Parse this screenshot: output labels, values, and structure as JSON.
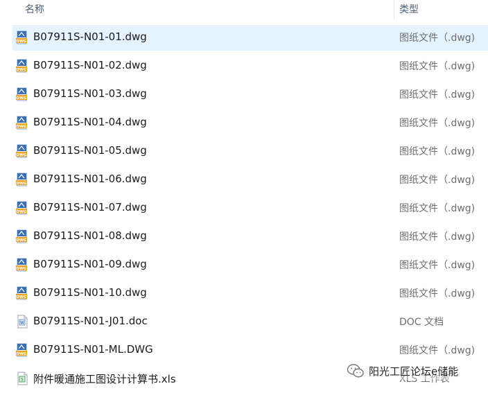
{
  "header": {
    "name_label": "名称",
    "type_label": "类型",
    "sort_indicator": "^"
  },
  "files": [
    {
      "name": "B07911S-N01-01.dwg",
      "type": "图纸文件（.dwg)",
      "icon": "dwg-file-icon",
      "selected": true
    },
    {
      "name": "B07911S-N01-02.dwg",
      "type": "图纸文件（.dwg)",
      "icon": "dwg-file-icon"
    },
    {
      "name": "B07911S-N01-03.dwg",
      "type": "图纸文件（.dwg)",
      "icon": "dwg-file-icon"
    },
    {
      "name": "B07911S-N01-04.dwg",
      "type": "图纸文件（.dwg)",
      "icon": "dwg-file-icon"
    },
    {
      "name": "B07911S-N01-05.dwg",
      "type": "图纸文件（.dwg)",
      "icon": "dwg-file-icon"
    },
    {
      "name": "B07911S-N01-06.dwg",
      "type": "图纸文件（.dwg)",
      "icon": "dwg-file-icon"
    },
    {
      "name": "B07911S-N01-07.dwg",
      "type": "图纸文件（.dwg)",
      "icon": "dwg-file-icon"
    },
    {
      "name": "B07911S-N01-08.dwg",
      "type": "图纸文件（.dwg)",
      "icon": "dwg-file-icon"
    },
    {
      "name": "B07911S-N01-09.dwg",
      "type": "图纸文件（.dwg)",
      "icon": "dwg-file-icon"
    },
    {
      "name": "B07911S-N01-10.dwg",
      "type": "图纸文件（.dwg)",
      "icon": "dwg-file-icon"
    },
    {
      "name": "B07911S-N01-J01.doc",
      "type": "DOC 文档",
      "icon": "doc-file-icon"
    },
    {
      "name": "B07911S-N01-ML.DWG",
      "type": "图纸文件（.dwg)",
      "icon": "dwg-file-icon"
    },
    {
      "name": "附件暖通施工图设计计算书.xls",
      "type": "XLS 工作表",
      "icon": "xls-file-icon"
    }
  ],
  "watermark": {
    "text": "阳光工匠论坛e储能",
    "icon": "wechat-logo-icon"
  },
  "colors": {
    "selected_row": "#e5f3ff",
    "header_text": "#4c607a",
    "type_text": "#6d6d6d",
    "dwg_icon_blue": "#3a6fb4",
    "dwg_icon_orange": "#f0a020",
    "xls_icon_green": "#2e8b3a"
  }
}
